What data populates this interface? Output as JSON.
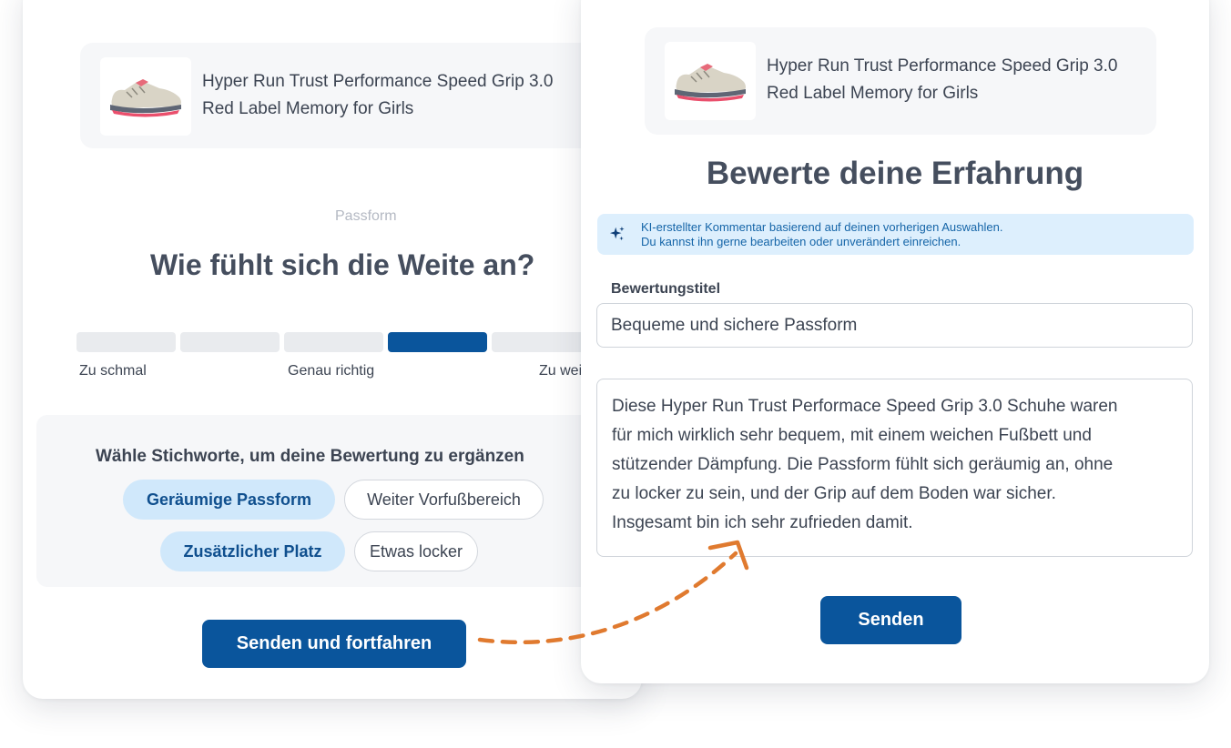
{
  "product": {
    "name_line1": "Hyper Run Trust Performance Speed Grip 3.0",
    "name_line2": "Red Label Memory for Girls"
  },
  "fit_step": {
    "eyebrow": "Passform",
    "question": "Wie fühlt sich die Weite an?",
    "scale": {
      "labels": [
        "Zu schmal",
        "Genau richtig",
        "Zu weit"
      ],
      "segments": 5,
      "selected_index": 3
    },
    "tags_title": "Wähle Stichworte, um deine Bewertung zu ergänzen",
    "tags": [
      {
        "label": "Geräumige Passform",
        "selected": true
      },
      {
        "label": "Weiter Vorfußbereich",
        "selected": false
      },
      {
        "label": "Zusätzlicher Platz",
        "selected": true
      },
      {
        "label": "Etwas locker",
        "selected": false
      }
    ],
    "submit_label": "Senden und fortfahren"
  },
  "review_step": {
    "title": "Bewerte deine Erfahrung",
    "ai_note": {
      "line1": "KI-erstellter Kommentar basierend auf deinen vorherigen Auswahlen.",
      "line2": "Du kannst ihn gerne bearbeiten oder unverändert einreichen."
    },
    "review_title_label": "Bewertungstitel",
    "review_title_value": "Bequeme und sichere Passform",
    "comment_lines": [
      "Diese Hyper Run Trust Performace Speed Grip 3.0 Schuhe waren",
      "für mich wirklich sehr bequem, mit einem weichen Fußbett und",
      "stützender Dämpfung. Die Passform fühlt sich geräumig an, ohne",
      "zu locker zu sein, und der Grip auf dem Boden war sicher.",
      "Insgesamt bin ich sehr zufrieden damit."
    ],
    "submit_label": "Senden"
  },
  "icons": {
    "product_image": "sneaker-icon",
    "ai_note": "sparkle-icon",
    "connector": "dashed-arrow-icon"
  },
  "colors": {
    "primary": "#0a559c",
    "tag_selected_bg": "#d0e8fb",
    "ai_note_bg": "#ddeffd",
    "arrow": "#e07a2f"
  }
}
